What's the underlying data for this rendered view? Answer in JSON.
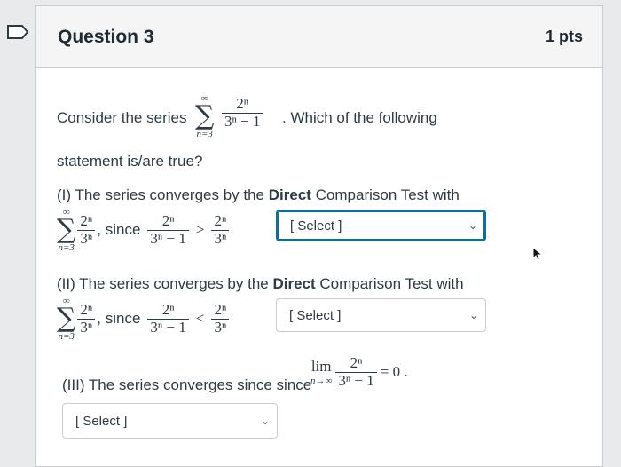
{
  "question": {
    "title": "Question 3",
    "points": "1 pts",
    "intro_before": "Consider the series",
    "intro_after": ". Which of the following",
    "intro_line2": "statement is/are true?"
  },
  "series": {
    "upper": "∞",
    "lower": "n=3",
    "numerator": "2ⁿ",
    "denominator": "3ⁿ − 1"
  },
  "statement1": {
    "prefix": "(I) The series converges by the ",
    "bold": "Direct",
    "suffix": " Comparison Test with",
    "comp_num": "2ⁿ",
    "comp_den": "3ⁿ",
    "since": ", since",
    "lhs_num": "2ⁿ",
    "lhs_den": "3ⁿ − 1",
    "relation": ">",
    "rhs_num": "2ⁿ",
    "rhs_den": "3ⁿ"
  },
  "statement2": {
    "prefix": "(II) The series converges by the ",
    "bold": "Direct",
    "suffix": " Comparison Test with",
    "comp_num": "2ⁿ",
    "comp_den": "3ⁿ",
    "since": ", since",
    "lhs_num": "2ⁿ",
    "lhs_den": "3ⁿ − 1",
    "relation": "<",
    "rhs_num": "2ⁿ",
    "rhs_den": "3ⁿ"
  },
  "statement3": {
    "text": "(III) The series converges since since",
    "lim": "lim",
    "lim_sub": "n→∞",
    "num": "2ⁿ",
    "den": "3ⁿ − 1",
    "result": "= 0 ."
  },
  "selects": {
    "s1": "[ Select ]",
    "s2": "[ Select ]",
    "s3": "[ Select ]"
  },
  "icons": {
    "bookmark": "bookmark-icon",
    "dropdown": "chevron-down-icon",
    "cursor": "mouse-pointer-icon"
  },
  "colors": {
    "focus_border": "#0770a3",
    "header_bg": "#f5f5f5"
  }
}
